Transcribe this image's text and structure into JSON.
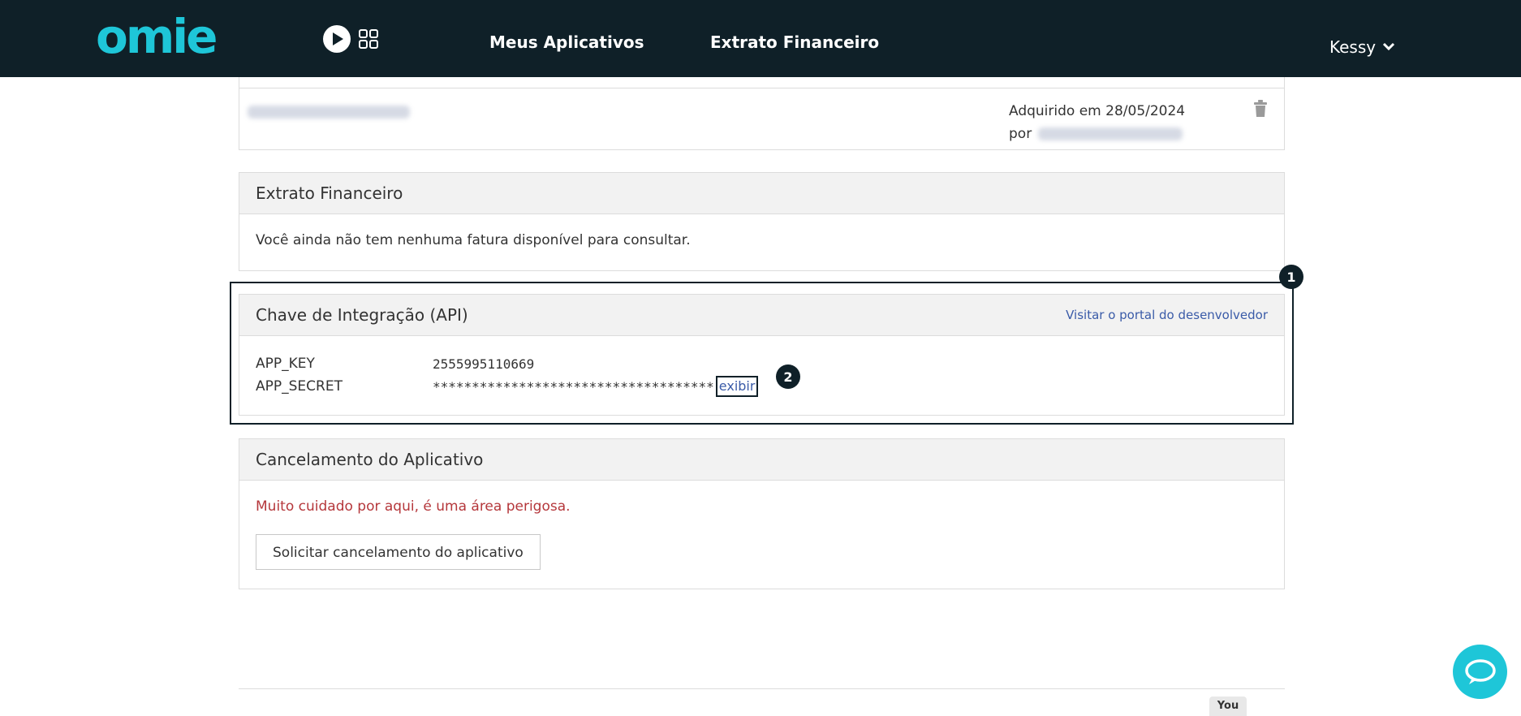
{
  "topbar": {
    "logo": "omie",
    "nav": [
      "Meus Aplicativos",
      "Extrato Financeiro"
    ],
    "user": "Kessy"
  },
  "acquired": {
    "text": "Adquirido em 28/05/2024",
    "by_label": "por"
  },
  "extrato": {
    "title": "Extrato Financeiro",
    "message": "Você ainda não tem nenhuma fatura disponível para consultar."
  },
  "api": {
    "title": "Chave de Integração (API)",
    "dev_link": "Visitar o portal do desenvolvedor",
    "app_key_label": "APP_KEY",
    "app_key_value": "2555995110669",
    "app_secret_label": "APP_SECRET",
    "app_secret_value": "************************************",
    "show_link": "exibir"
  },
  "annotations": {
    "badge1": "1",
    "badge2": "2"
  },
  "cancel": {
    "title": "Cancelamento do Aplicativo",
    "warning": "Muito cuidado por aqui, é uma área perigosa.",
    "button": "Solicitar cancelamento do aplicativo"
  },
  "footer": {
    "youtube": "You"
  },
  "colors": {
    "topbar": "#0f2028",
    "brand": "#1ec6d8",
    "link": "#3a5ba8",
    "danger": "#b5373b"
  }
}
